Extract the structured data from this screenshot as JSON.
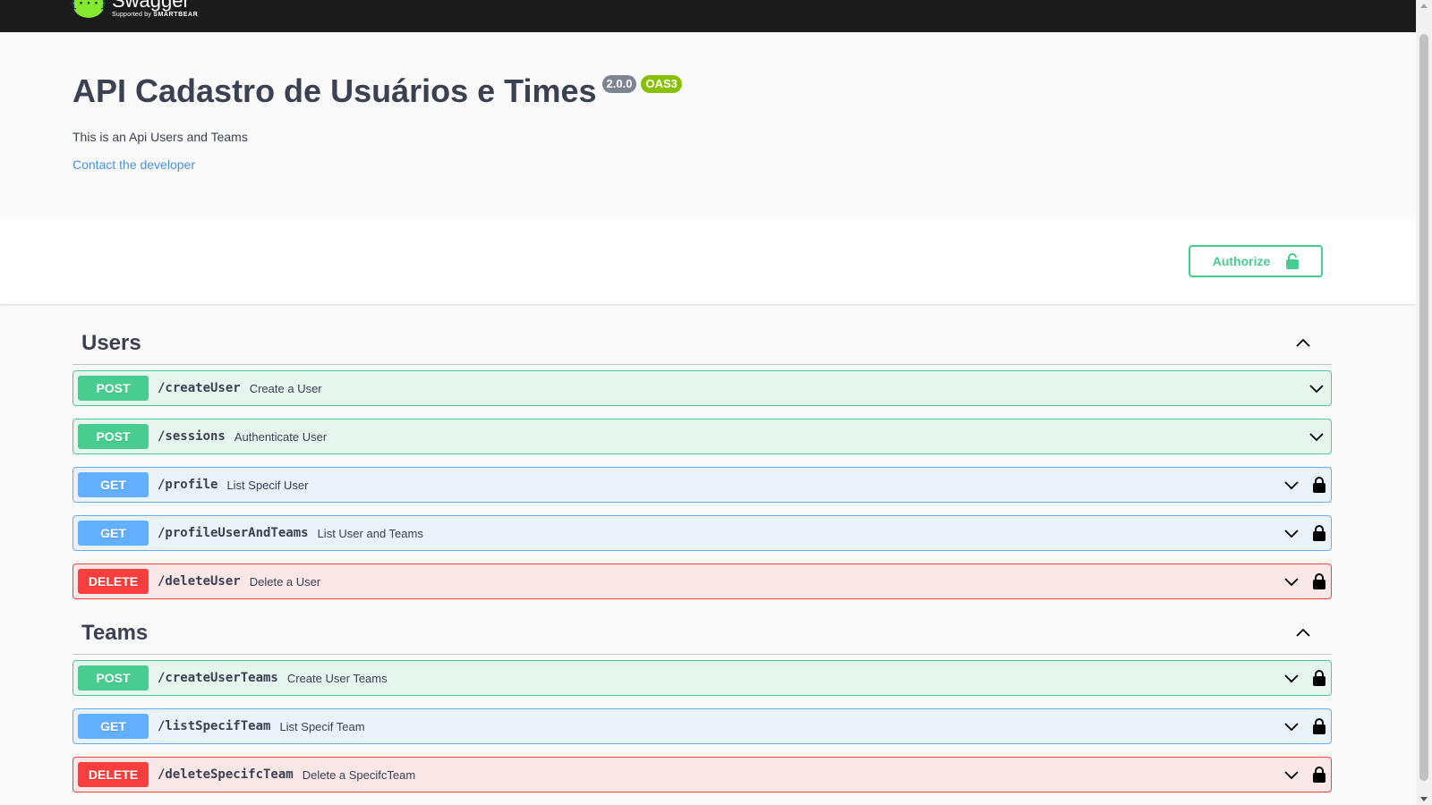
{
  "topbar": {
    "logo_mark": "{···}",
    "logo_name": "Swagger",
    "logo_sub_prefix": "Supported by",
    "logo_sub_brand": "SMARTBEAR"
  },
  "info": {
    "title": "API Cadastro de Usuários e Times",
    "version": "2.0.0",
    "oas": "OAS3",
    "description": "This is an Api Users and Teams",
    "contact": "Contact the developer"
  },
  "scheme": {
    "authorize_label": "Authorize"
  },
  "colors": {
    "post": "#49cc90",
    "get": "#61affe",
    "delete": "#f93e3e",
    "topbar": "#1b1b1b"
  },
  "tags": [
    {
      "name": "Users",
      "operations": [
        {
          "method": "POST",
          "path": "/createUser",
          "summary": "Create a User",
          "locked": false
        },
        {
          "method": "POST",
          "path": "/sessions",
          "summary": "Authenticate User",
          "locked": false
        },
        {
          "method": "GET",
          "path": "/profile",
          "summary": "List Specif User",
          "locked": true
        },
        {
          "method": "GET",
          "path": "/profileUserAndTeams",
          "summary": "List User and Teams",
          "locked": true
        },
        {
          "method": "DELETE",
          "path": "/deleteUser",
          "summary": "Delete a User",
          "locked": true
        }
      ]
    },
    {
      "name": "Teams",
      "operations": [
        {
          "method": "POST",
          "path": "/createUserTeams",
          "summary": "Create User Teams",
          "locked": true
        },
        {
          "method": "GET",
          "path": "/listSpecifTeam",
          "summary": "List Specif Team",
          "locked": true
        },
        {
          "method": "DELETE",
          "path": "/deleteSpecifcTeam",
          "summary": "Delete a SpecifcTeam",
          "locked": true
        }
      ]
    }
  ]
}
